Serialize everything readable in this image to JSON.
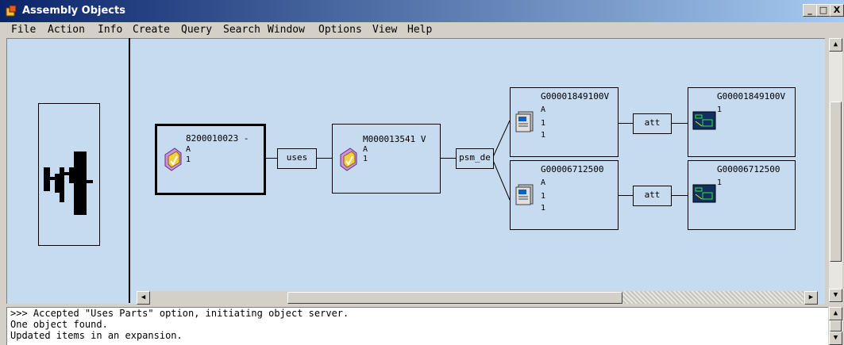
{
  "window": {
    "title": "Assembly Objects",
    "min_label": "_",
    "max_label": "□",
    "close_label": "X"
  },
  "menu": {
    "file": "File",
    "action": "Action",
    "info": "Info",
    "create": "Create",
    "query": "Query",
    "search": "Search",
    "window": "Window",
    "options": "Options",
    "view": "View",
    "help": "Help"
  },
  "graph": {
    "root": {
      "title": "8200010023 -",
      "rev": "A",
      "qty": "1"
    },
    "child": {
      "title": "M000013541 V",
      "rev": "A",
      "qty": "1"
    },
    "rel_uses": "uses",
    "rel_psm": "psm_de",
    "g1": {
      "title": "G00001849100V",
      "rev": "A",
      "l2": "1",
      "l3": "1"
    },
    "g2": {
      "title": "G00006712500",
      "rev": "A",
      "l2": "1",
      "l3": "1"
    },
    "rel_att1": "att",
    "rel_att2": "att",
    "d1": {
      "title": "G00001849100V",
      "qty": "1"
    },
    "d2": {
      "title": "G00006712500",
      "qty": "1"
    }
  },
  "console": {
    "lines": [
      ">>> Accepted \"Uses Parts\" option, initiating object server.",
      "One object found.",
      "Updated items in an expansion."
    ]
  }
}
